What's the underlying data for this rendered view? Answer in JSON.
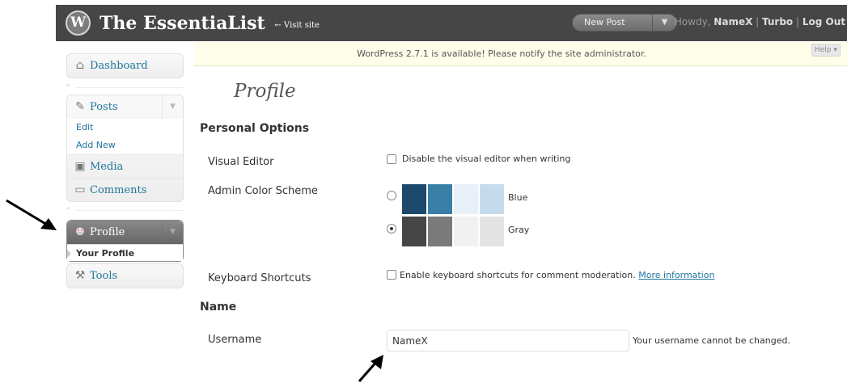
{
  "header": {
    "logo_glyph": "W",
    "site_title": "The EssentiaList",
    "visit_site": "← Visit site",
    "new_post": "New Post",
    "howdy_prefix": "Howdy, ",
    "username": "NameX",
    "sep1": " | ",
    "turbo": "Turbo",
    "sep2": " | ",
    "logout": "Log Out"
  },
  "notice": {
    "text": "WordPress 2.7.1 is available! Please notify the site administrator.",
    "help": "Help ▾"
  },
  "sidebar": {
    "dashboard": "Dashboard",
    "posts": "Posts",
    "posts_sub": [
      "Edit",
      "Add New"
    ],
    "media": "Media",
    "comments": "Comments",
    "profile": "Profile",
    "your_profile": "Your Profile",
    "tools": "Tools"
  },
  "main": {
    "title": "Profile",
    "personal_options": "Personal Options",
    "visual_editor_label": "Visual Editor",
    "visual_editor_option": "Disable the visual editor when writing",
    "color_scheme_label": "Admin Color Scheme",
    "schemes": [
      {
        "name": "Blue",
        "selected": false,
        "colors": [
          "#1d4a6c",
          "#3a7fa6",
          "#e7f0f8",
          "#c6dbeb"
        ]
      },
      {
        "name": "Gray",
        "selected": true,
        "colors": [
          "#464646",
          "#7a7a7a",
          "#f1f1f1",
          "#e3e3e3"
        ]
      }
    ],
    "keyboard_label": "Keyboard Shortcuts",
    "keyboard_option": "Enable keyboard shortcuts for comment moderation.",
    "keyboard_link": "More information",
    "name_heading": "Name",
    "username_label": "Username",
    "username_value": "NameX",
    "username_desc": "Your username cannot be changed."
  },
  "colors": {
    "header_bg": "#464646",
    "link": "#21759b",
    "notice_bg": "#fffeeb"
  }
}
